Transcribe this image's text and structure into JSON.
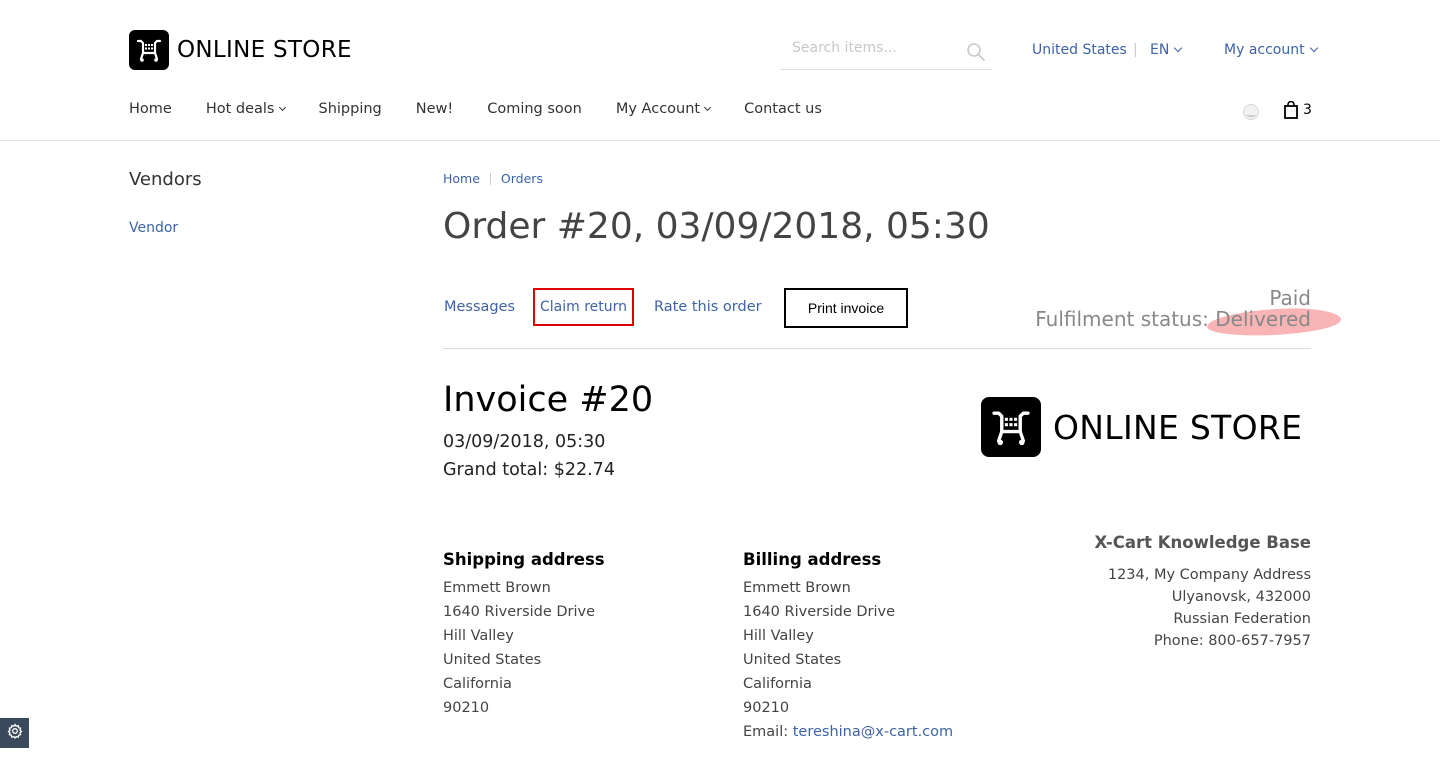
{
  "header": {
    "logo_text": "ONLINE STORE",
    "search_placeholder": "Search items...",
    "country": "United States",
    "country_sep": "|",
    "language": "EN",
    "my_account": "My account",
    "cart_count": "3"
  },
  "nav": {
    "items": [
      {
        "label": "Home",
        "has_dropdown": false
      },
      {
        "label": "Hot deals",
        "has_dropdown": true
      },
      {
        "label": "Shipping",
        "has_dropdown": false
      },
      {
        "label": "New!",
        "has_dropdown": false
      },
      {
        "label": "Coming soon",
        "has_dropdown": false
      },
      {
        "label": "My Account",
        "has_dropdown": true
      },
      {
        "label": "Contact us",
        "has_dropdown": false
      }
    ]
  },
  "sidebar": {
    "title": "Vendors",
    "link": "Vendor"
  },
  "breadcrumb": {
    "home": "Home",
    "orders": "Orders"
  },
  "order": {
    "title": "Order #20, 03/09/2018, 05:30",
    "tabs": {
      "messages": "Messages",
      "claim_return": "Claim return",
      "rate": "Rate this order",
      "print": "Print invoice"
    },
    "payment_status": "Paid",
    "fulfilment_label": "Fulfilment status:",
    "fulfilment_value": "Delivered"
  },
  "invoice": {
    "title": "Invoice #20",
    "date": "03/09/2018, 05:30",
    "grand_total": "Grand total: $22.74",
    "logo_text": "ONLINE STORE",
    "shipping": {
      "title": "Shipping address",
      "name": "Emmett  Brown",
      "street": "1640 Riverside Drive",
      "city": "Hill Valley",
      "country": "United States",
      "state": "California",
      "zip": "90210"
    },
    "billing": {
      "title": "Billing address",
      "name": "Emmett  Brown",
      "street": "1640 Riverside Drive",
      "city": "Hill Valley",
      "country": "United States",
      "state": "California",
      "zip": "90210",
      "email_label": "Email: ",
      "email": "tereshina@x-cart.com"
    },
    "company": {
      "name": "X-Cart Knowledge Base",
      "address": "1234, My Company Address",
      "city": "Ulyanovsk, 432000",
      "country": "Russian Federation",
      "phone": "Phone: 800-657-7957"
    }
  },
  "colors": {
    "link": "#3d63a6",
    "claim_border": "#e00000",
    "highlight": "#f47878"
  },
  "icons": [
    "cart-logo-icon",
    "search-icon",
    "theme-toggle-icon",
    "shopping-bag-icon",
    "gear-icon"
  ]
}
